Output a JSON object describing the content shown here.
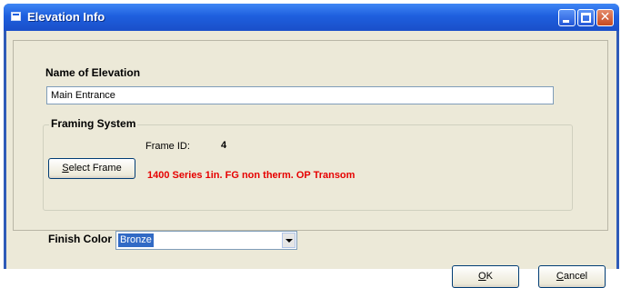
{
  "window": {
    "title": "Elevation Info",
    "title_bar_color": "#1e5fde"
  },
  "form": {
    "name_label": "Name of Elevation",
    "name_value": "Main Entrance",
    "framing_system_label": "Framing System",
    "frame_id_label": "Frame ID:",
    "frame_id_value": "4",
    "select_frame_label": "Select Frame",
    "frame_description": "1400 Series 1in. FG non therm. OP Transom",
    "frame_description_color": "#e60000",
    "finish_color_label": "Finish Color",
    "finish_color_value": "Bronze"
  },
  "buttons": {
    "ok_label": "OK",
    "cancel_label": "Cancel"
  },
  "icons": [
    "window-app-icon",
    "minimize-icon",
    "maximize-icon",
    "close-icon",
    "dropdown-arrow-icon"
  ]
}
